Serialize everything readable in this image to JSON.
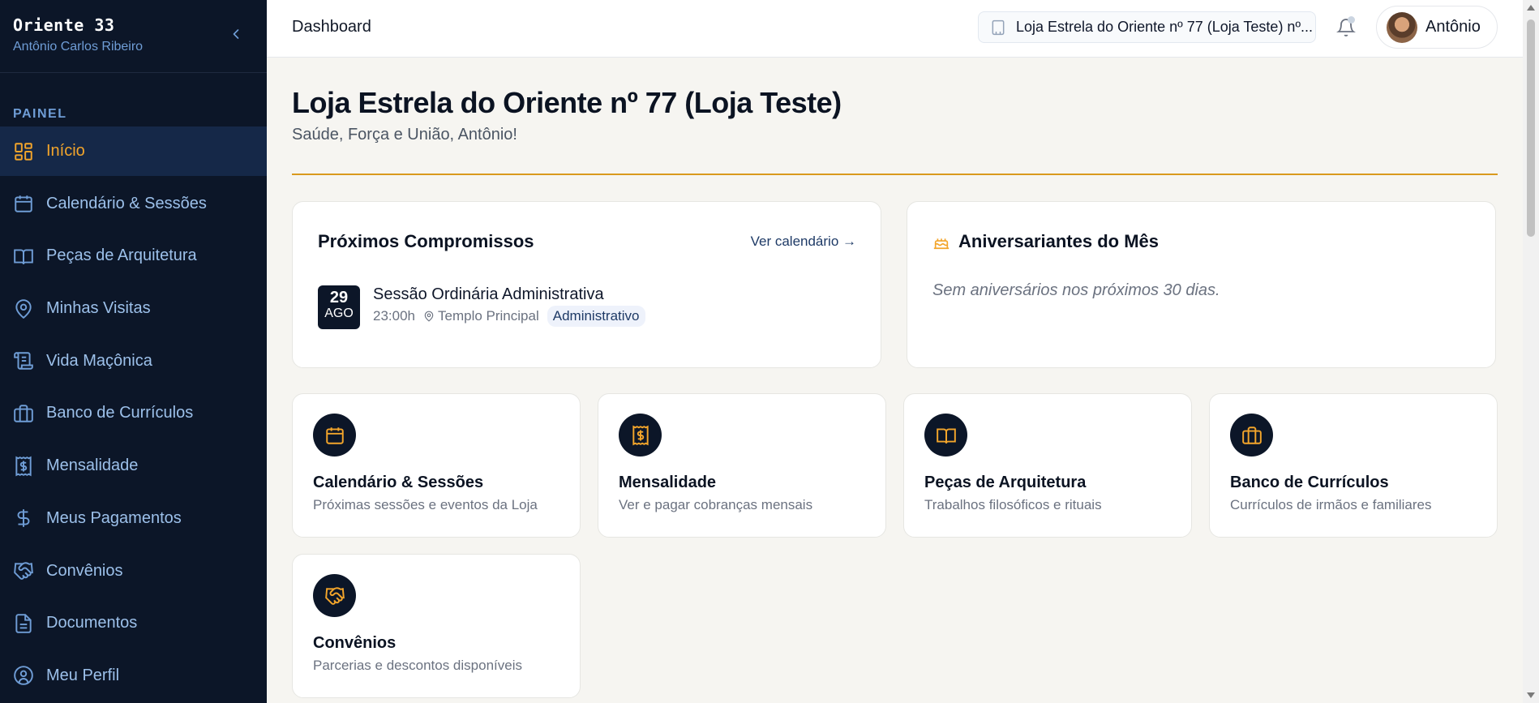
{
  "sidebar": {
    "title": "Oriente 33",
    "user": "Antônio Carlos Ribeiro",
    "section": "PAINEL",
    "items": [
      {
        "label": "Início",
        "icon": "grid-icon"
      },
      {
        "label": "Calendário & Sessões",
        "icon": "calendar-icon"
      },
      {
        "label": "Peças de Arquitetura",
        "icon": "book-icon"
      },
      {
        "label": "Minhas Visitas",
        "icon": "map-pin-icon"
      },
      {
        "label": "Vida Maçônica",
        "icon": "scroll-icon"
      },
      {
        "label": "Banco de Currículos",
        "icon": "briefcase-icon"
      },
      {
        "label": "Mensalidade",
        "icon": "receipt-icon"
      },
      {
        "label": "Meus Pagamentos",
        "icon": "dollar-icon"
      },
      {
        "label": "Convênios",
        "icon": "handshake-icon"
      },
      {
        "label": "Documentos",
        "icon": "document-icon"
      },
      {
        "label": "Meu Perfil",
        "icon": "user-circle-icon"
      }
    ]
  },
  "header": {
    "breadcrumb": "Dashboard",
    "lodge": "Loja Estrela do Oriente nº 77 (Loja Teste) nº...",
    "user_name": "Antônio"
  },
  "main": {
    "title": "Loja Estrela do Oriente nº 77 (Loja Teste)",
    "greeting": "Saúde, Força e União, Antônio!",
    "appointments": {
      "title": "Próximos Compromissos",
      "link": "Ver calendário →",
      "event": {
        "day": "29",
        "month": "AGO",
        "title": "Sessão Ordinária Administrativa",
        "time": "23:00h",
        "place": "Templo Principal",
        "tag": "Administrativo"
      }
    },
    "birthdays": {
      "title": "Aniversariantes do Mês",
      "empty": "Sem aniversários nos próximos 30 dias."
    },
    "tiles": [
      {
        "title": "Calendário & Sessões",
        "desc": "Próximas sessões e eventos da Loja"
      },
      {
        "title": "Mensalidade",
        "desc": "Ver e pagar cobranças mensais"
      },
      {
        "title": "Peças de Arquitetura",
        "desc": "Trabalhos filosóficos e rituais"
      },
      {
        "title": "Banco de Currículos",
        "desc": "Currículos de irmãos e familiares"
      },
      {
        "title": "Convênios",
        "desc": "Parcerias e descontos disponíveis"
      }
    ]
  },
  "colors": {
    "sidebar_bg": "#0c1628",
    "accent": "#f3a52b",
    "rule": "#d99a1e",
    "link": "#1e3a66"
  }
}
